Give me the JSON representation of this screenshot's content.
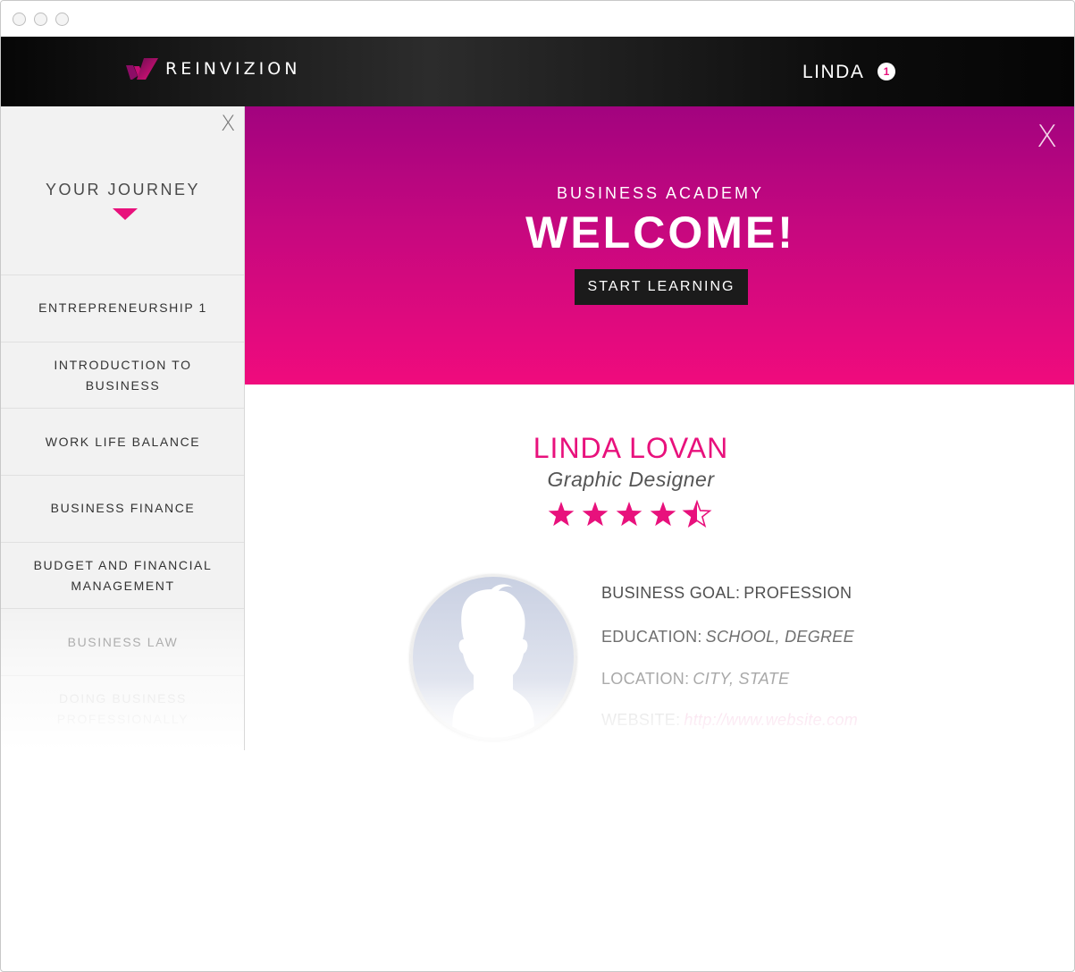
{
  "app": {
    "brand": "REINVIZION",
    "user_name": "LINDA",
    "notification_count": "1"
  },
  "sidebar": {
    "close_label": "X",
    "title": "YOUR JOURNEY",
    "items": [
      {
        "label": "ENTREPRENEURSHIP 1"
      },
      {
        "label": "INTRODUCTION TO BUSINESS"
      },
      {
        "label": "WORK LIFE BALANCE"
      },
      {
        "label": "BUSINESS FINANCE"
      },
      {
        "label": "BUDGET AND FINANCIAL MANAGEMENT"
      },
      {
        "label": "BUSINESS LAW"
      },
      {
        "label": "DOING BUSINESS PROFESSIONALLY"
      }
    ]
  },
  "hero": {
    "close_label": "X",
    "subtitle": "BUSINESS ACADEMY",
    "title": "WELCOME!",
    "cta_label": "START LEARNING"
  },
  "profile": {
    "name": "LINDA LOVAN",
    "role": "Graphic Designer",
    "rating": 4.5,
    "rating_max": 5,
    "fields": {
      "goal_label": "BUSINESS GOAL:",
      "goal_value": "PROFESSION",
      "education_label": "EDUCATION:",
      "education_value": "SCHOOL, DEGREE",
      "location_label": "LOCATION:",
      "location_value": "CITY, STATE",
      "website_label": "WEBSITE:",
      "website_value": "http://www.website.com"
    }
  },
  "colors": {
    "accent": "#e8117c",
    "hero_top": "#a2037f",
    "hero_bottom": "#f00b7d",
    "topbar": "#111111",
    "button_bg": "#1b1b1b"
  },
  "icons": {
    "logo": "reinvizion-logo-mark",
    "avatar": "user-silhouette-icon",
    "star": "star-icon"
  }
}
